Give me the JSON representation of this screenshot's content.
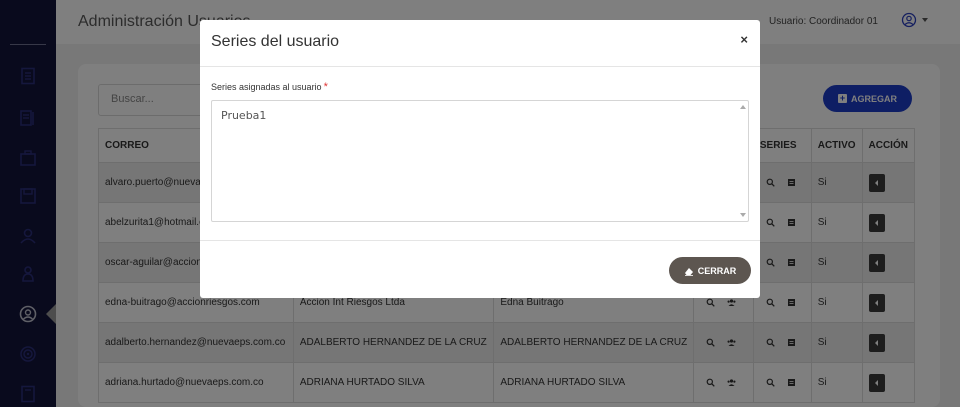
{
  "header": {
    "title": "Administración Usuarios",
    "user_label": "Usuario: Coordinador 01"
  },
  "toolbar": {
    "search_placeholder": "Buscar...",
    "add_label": "AGREGAR"
  },
  "table": {
    "columns": [
      "CORREO",
      "",
      "",
      "",
      "SERIES",
      "ACTIVO",
      "ACCIÓN"
    ],
    "rows": [
      {
        "correo": "alvaro.puerto@nuevaeps.com.co",
        "empresa": "",
        "nombre": "",
        "activo": "Si"
      },
      {
        "correo": "abelzurita1@hotmail.com",
        "empresa": "",
        "nombre": "",
        "activo": "Si"
      },
      {
        "correo": "oscar-aguilar@accionriesgos.com",
        "empresa": "",
        "nombre": "",
        "activo": "Si"
      },
      {
        "correo": "edna-buitrago@accionriesgos.com",
        "empresa": "Accion Int Riesgos Ltda",
        "nombre": "Edna Buitrago",
        "activo": "Si"
      },
      {
        "correo": "adalberto.hernandez@nuevaeps.com.co",
        "empresa": "ADALBERTO HERNANDEZ DE LA CRUZ",
        "nombre": "ADALBERTO HERNANDEZ DE LA CRUZ",
        "activo": "Si"
      },
      {
        "correo": "adriana.hurtado@nuevaeps.com.co",
        "empresa": "ADRIANA HURTADO SILVA",
        "nombre": "ADRIANA HURTADO SILVA",
        "activo": "Si"
      }
    ]
  },
  "modal": {
    "title": "Series del usuario",
    "close_glyph": "×",
    "field_label": "Series asignadas al usuario",
    "required_mark": "*",
    "field_value": "Prueba1",
    "close_button_label": "CERRAR"
  },
  "colors": {
    "sidebar": "#13153a",
    "primary": "#1d3cc9",
    "close_button": "#5d5650"
  }
}
